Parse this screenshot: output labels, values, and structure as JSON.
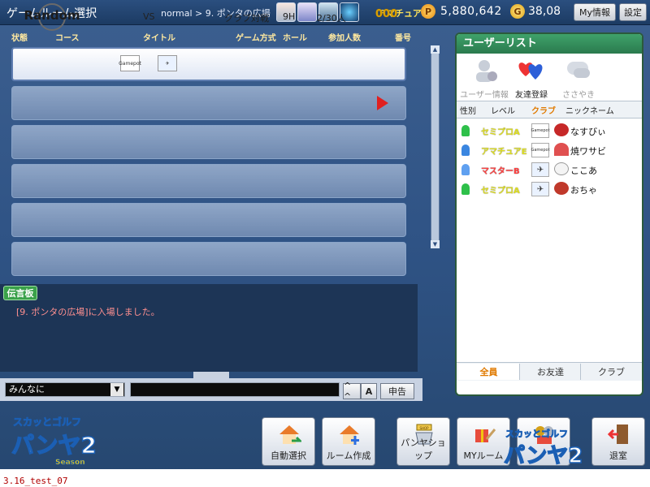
{
  "header": {
    "title": "ゲームルーム選択",
    "breadcrumb": "normal > 9. ポンタの広場",
    "rank": "アマチュアE",
    "points_icon": "P",
    "points": "5,880,642",
    "gold_icon": "G",
    "gold": "38,08",
    "myinfo_label": "My情報",
    "settings_label": "設定"
  },
  "columns": {
    "status": "状態",
    "course": "コース",
    "title": "タイトル",
    "mode": "ゲーム方式",
    "holes": "ホール",
    "players": "参加人数",
    "number": "番号"
  },
  "rooms": [
    {
      "course": "Random",
      "club_a": "Gamepot",
      "vs": "VS",
      "mode": "クラブ対戦",
      "holes": "9H",
      "players": "2/30人",
      "number": "000"
    }
  ],
  "board": {
    "tag": "伝言板",
    "message": "[9. ポンタの広場]に入場しました。"
  },
  "chat": {
    "target": "みんなに",
    "input_value": "",
    "emote_label": "^ ^",
    "font_label": "A",
    "report_label": "申告"
  },
  "userlist": {
    "title": "ユーザーリスト",
    "actions": {
      "info": "ユーザー情報",
      "friend": "友達登録",
      "whisper": "ささやき"
    },
    "columns": {
      "gender": "性別",
      "level": "レベル",
      "club": "クラブ",
      "nickname": "ニックネーム"
    },
    "users": [
      {
        "rank": "セミプロA",
        "club": "Gamepot",
        "name": "なすびぃ",
        "rank_color": "#f4f44a"
      },
      {
        "rank": "アマチュアE",
        "club": "Gamepot",
        "name": "焼ワサビ",
        "rank_color": "#f4f44a"
      },
      {
        "rank": "マスターB",
        "club": "",
        "name": "ここあ",
        "rank_color": "#ff5a5a"
      },
      {
        "rank": "セミプロA",
        "club": "",
        "name": "おちゃ",
        "rank_color": "#f4f44a"
      }
    ],
    "tabs": {
      "all": "全員",
      "friends": "お友達",
      "club": "クラブ"
    }
  },
  "buttons": {
    "auto_select": "自動選択",
    "create_room": "ルーム作成",
    "shop": "パンヤショップ",
    "myroom": "MYルーム"
  },
  "logo": {
    "line1": "スカッとゴルフ",
    "line2": "パンヤ2",
    "line3": "Season"
  },
  "shop_sign": "SHOP",
  "version": "3.16_test_07"
}
